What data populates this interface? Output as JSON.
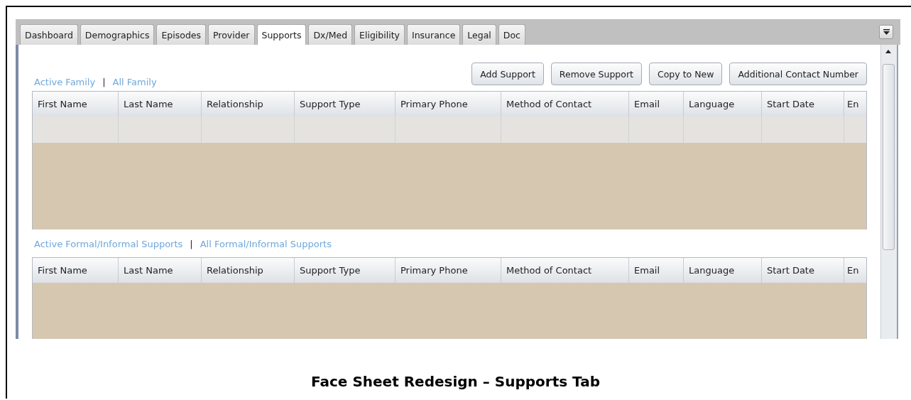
{
  "tabs": [
    {
      "label": "Dashboard",
      "selected": false
    },
    {
      "label": "Demographics",
      "selected": false
    },
    {
      "label": "Episodes",
      "selected": false
    },
    {
      "label": "Provider",
      "selected": false
    },
    {
      "label": "Supports",
      "selected": true
    },
    {
      "label": "Dx/Med",
      "selected": false
    },
    {
      "label": "Eligibility",
      "selected": false
    },
    {
      "label": "Insurance",
      "selected": false
    },
    {
      "label": "Legal",
      "selected": false
    },
    {
      "label": "Doc",
      "selected": false
    }
  ],
  "sections": [
    {
      "links": [
        "Active Family",
        "All Family"
      ],
      "separator": "|",
      "buttons": [
        "Add Support",
        "Remove Support",
        "Copy to New",
        "Additional Contact Number"
      ],
      "table": {
        "columns": [
          "First Name",
          "Last Name",
          "Relationship",
          "Support Type",
          "Primary Phone",
          "Method of Contact",
          "Email",
          "Language",
          "Start Date",
          "En"
        ],
        "rows": [
          {
            "kind": "blank"
          }
        ]
      }
    },
    {
      "links": [
        "Active Formal/Informal Supports",
        "All Formal/Informal Supports"
      ],
      "separator": "|",
      "table": {
        "columns": [
          "First Name",
          "Last Name",
          "Relationship",
          "Support Type",
          "Primary Phone",
          "Method of Contact",
          "Email",
          "Language",
          "Start Date",
          "En"
        ]
      }
    }
  ],
  "caption": "Face Sheet Redesign – Supports Tab"
}
